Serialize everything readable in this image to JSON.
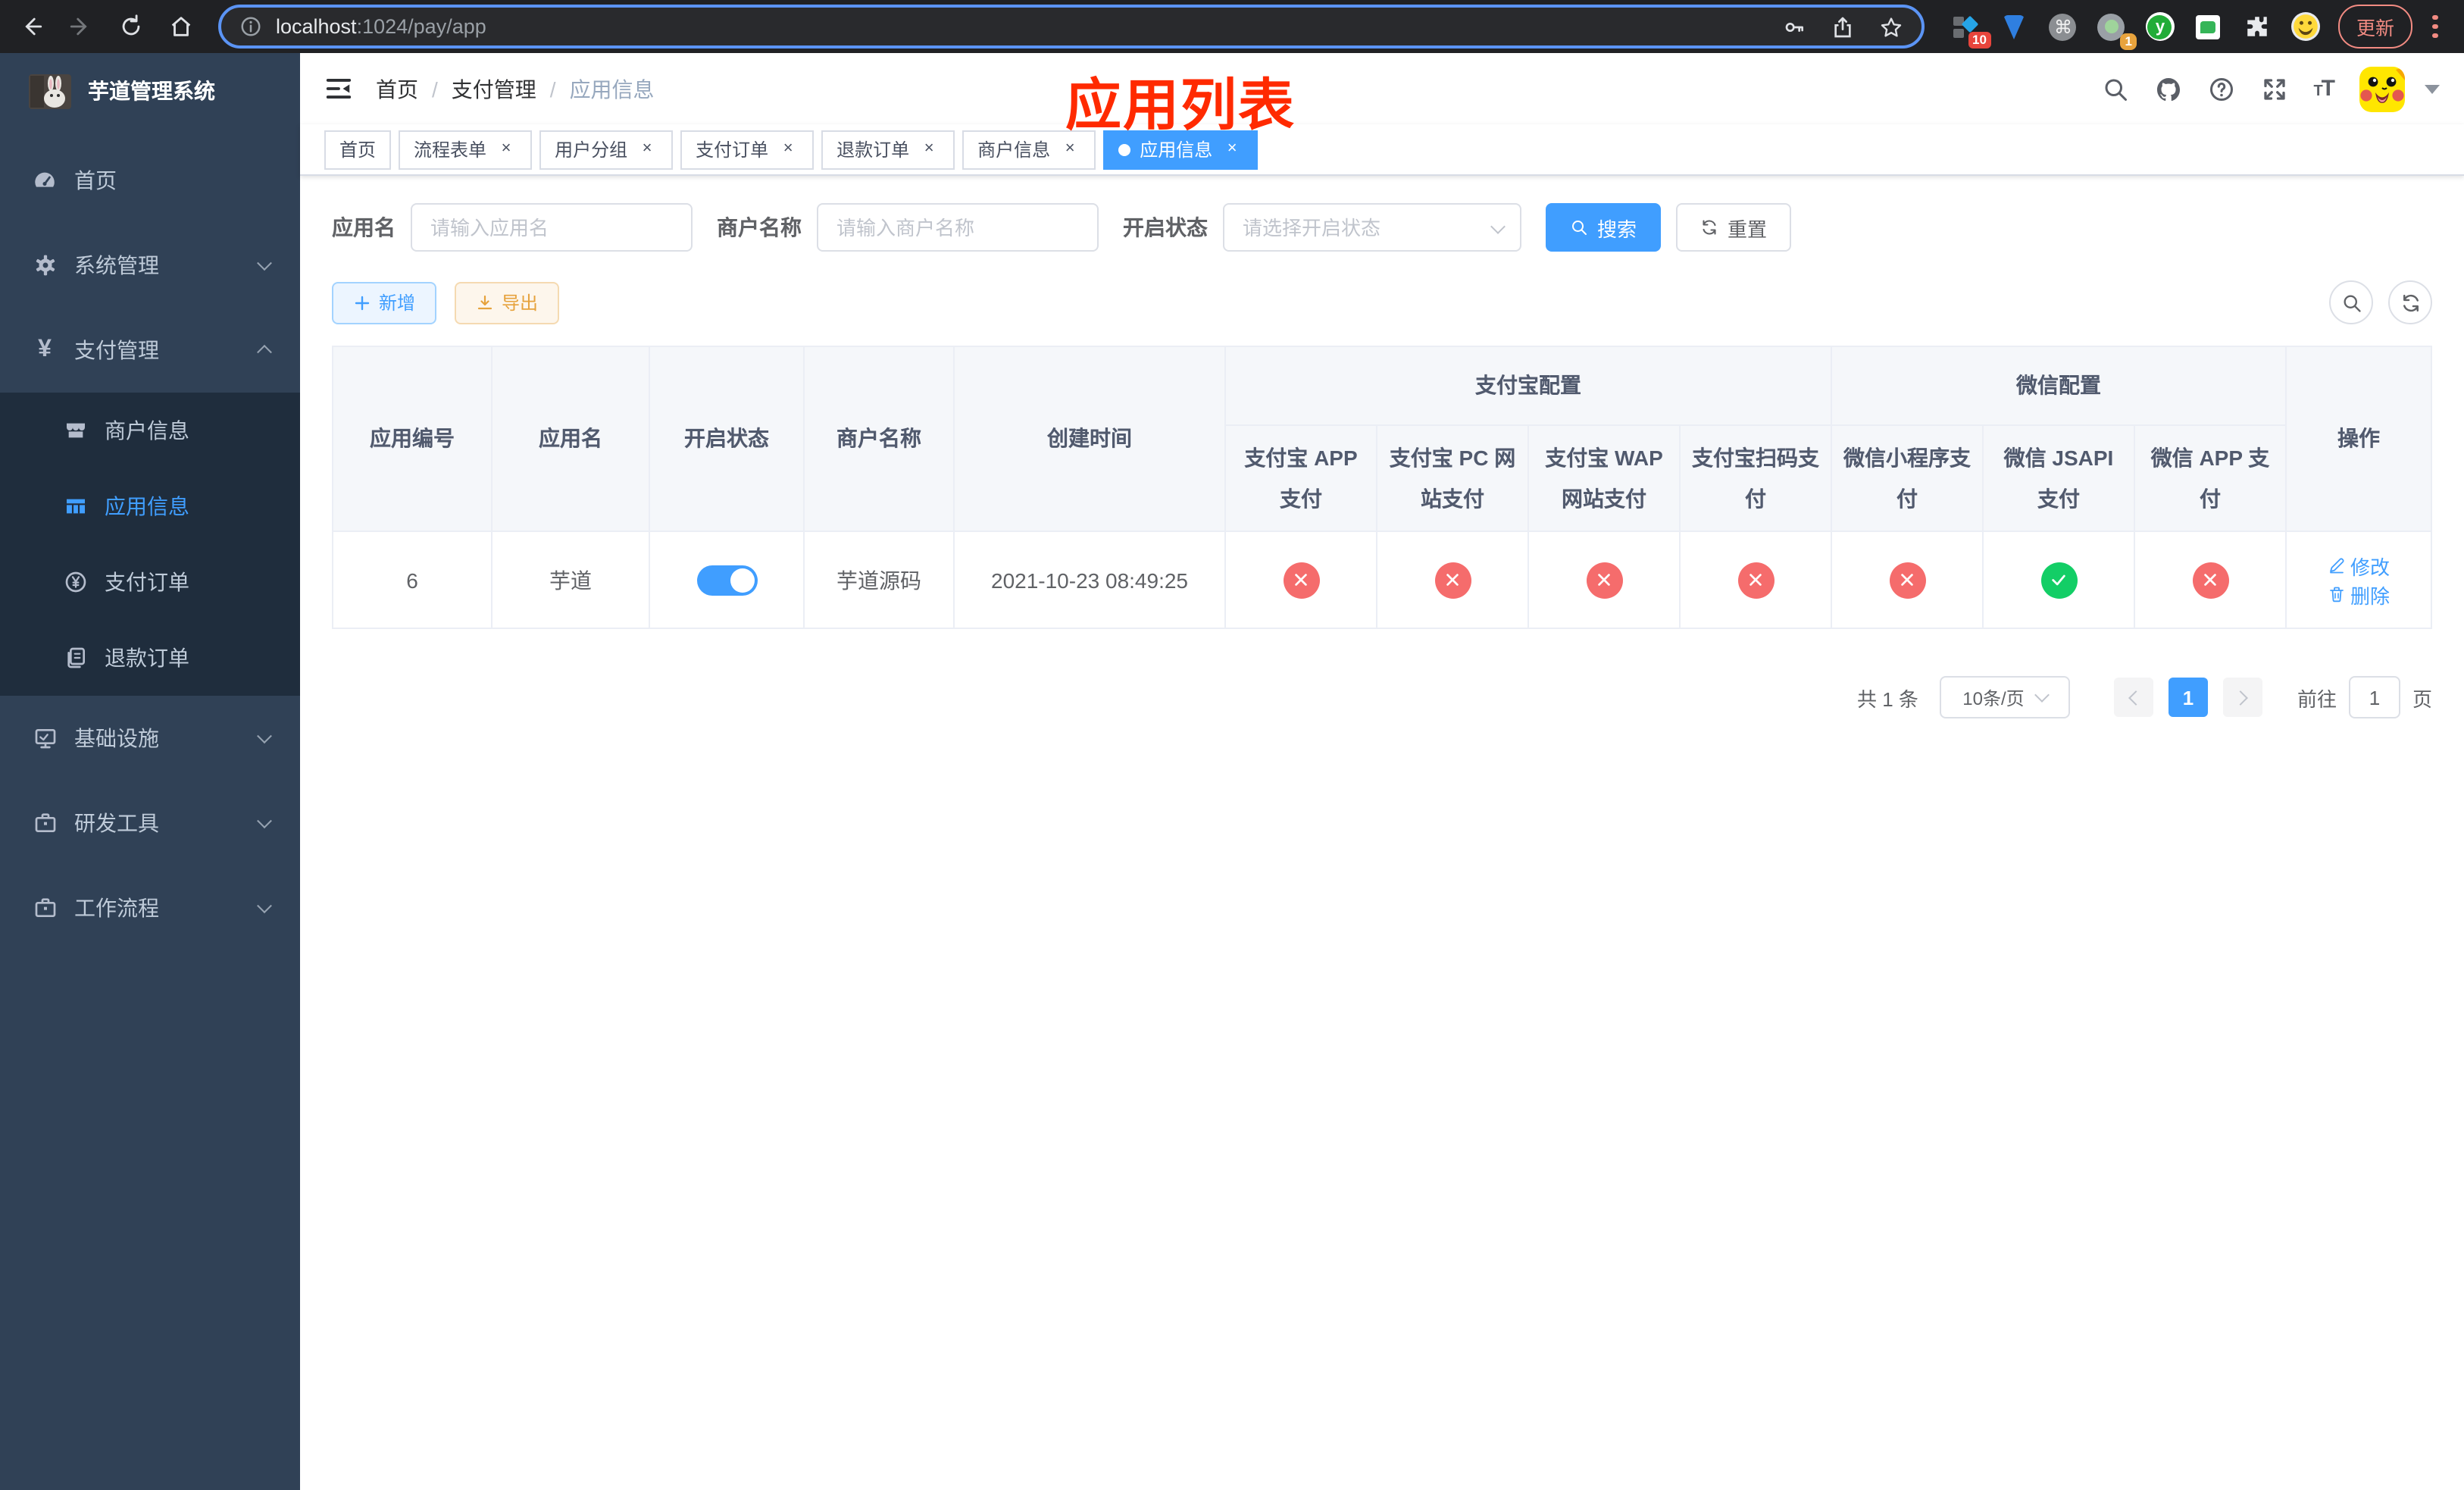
{
  "browser": {
    "url": {
      "host": "localhost",
      "path": ":1024/pay/app"
    },
    "update_label": "更新",
    "ext_badges": {
      "panel": "10",
      "recorder": "1"
    },
    "ext_y_letter": "y",
    "cmd_glyph": "⌘"
  },
  "sidebar": {
    "title": "芋道管理系统",
    "items": [
      {
        "label": "首页"
      },
      {
        "label": "系统管理"
      },
      {
        "label": "支付管理"
      },
      {
        "label": "商户信息"
      },
      {
        "label": "应用信息"
      },
      {
        "label": "支付订单"
      },
      {
        "label": "退款订单"
      },
      {
        "label": "基础设施"
      },
      {
        "label": "研发工具"
      },
      {
        "label": "工作流程"
      }
    ],
    "pay_icon_glyph": "¥"
  },
  "navbar": {
    "breadcrumb": {
      "0": "首页",
      "1": "支付管理",
      "2": "应用信息",
      "separator": "/"
    },
    "overlay_title": "应用列表"
  },
  "tabs": [
    {
      "label": "首页"
    },
    {
      "label": "流程表单"
    },
    {
      "label": "用户分组"
    },
    {
      "label": "支付订单"
    },
    {
      "label": "退款订单"
    },
    {
      "label": "商户信息"
    },
    {
      "label": "应用信息"
    }
  ],
  "tab_close_glyph": "×",
  "filters": {
    "app_name": {
      "label": "应用名",
      "placeholder": "请输入应用名",
      "value": ""
    },
    "merchant_name": {
      "label": "商户名称",
      "placeholder": "请输入商户名称",
      "value": ""
    },
    "status": {
      "label": "开启状态",
      "placeholder": "请选择开启状态",
      "value": ""
    },
    "search_label": "搜索",
    "reset_label": "重置"
  },
  "toolbar": {
    "add_label": "新增",
    "export_label": "导出"
  },
  "table": {
    "columns": {
      "app_id": "应用编号",
      "app_name": "应用名",
      "status": "开启状态",
      "merchant": "商户名称",
      "created": "创建时间",
      "op": "操作"
    },
    "groups": {
      "alipay": "支付宝配置",
      "wechat": "微信配置"
    },
    "sub_columns": [
      "支付宝 APP 支付",
      "支付宝 PC 网站支付",
      "支付宝 WAP 网站支付",
      "支付宝扫码支付",
      "微信小程序支付",
      "微信 JSAPI 支付",
      "微信 APP 支付"
    ],
    "row": {
      "app_id": "6",
      "app_name": "芋道",
      "status_on": true,
      "merchant": "芋道源码",
      "created": "2021-10-23 08:49:25",
      "pay_channels": [
        "disabled",
        "disabled",
        "disabled",
        "disabled",
        "disabled",
        "enabled",
        "disabled"
      ],
      "edit_label": "修改",
      "delete_label": "删除"
    }
  },
  "pagination": {
    "total": "共 1 条",
    "page_size": "10条/页",
    "current_page": "1",
    "goto_label": "前往",
    "page_unit": "页",
    "goto_value": "1"
  },
  "colors": {
    "primary": "#409eff",
    "danger": "#f56c6c",
    "success": "#13ce66",
    "warning": "#e6a23c",
    "annotation_red": "#ff2a00",
    "sidebar_bg": "#304156",
    "submenu_bg": "#1f2d3d"
  }
}
